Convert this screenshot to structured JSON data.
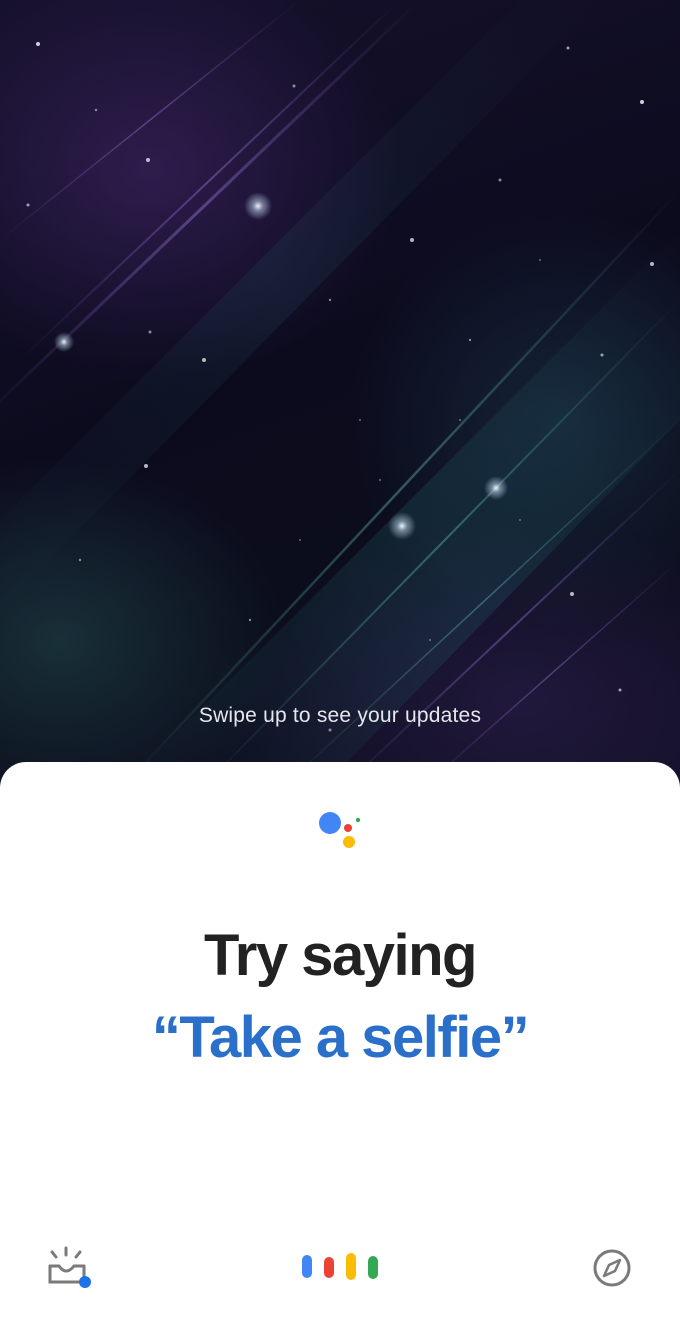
{
  "wallpaper": {
    "hint": "Swipe up to see your updates"
  },
  "assistant": {
    "logo_colors": [
      "#4285F4",
      "#EA4335",
      "#FBBC05",
      "#34A853"
    ],
    "heading": "Try saying",
    "suggestion": "“Take a selfie”"
  },
  "bottom_bar": {
    "left_icon": "updates-inbox-icon",
    "center_icon": "assistant-mic-dots-icon",
    "right_icon": "compass-explore-icon",
    "mic_dot_colors": [
      "#4285F4",
      "#EA4335",
      "#FBBC05",
      "#34A853"
    ],
    "notification_dot_color": "#1a73e8",
    "icon_color": "#7a7a7a"
  },
  "colors": {
    "suggestion_blue": "#2a6fc9",
    "heading_dark": "#222222"
  }
}
